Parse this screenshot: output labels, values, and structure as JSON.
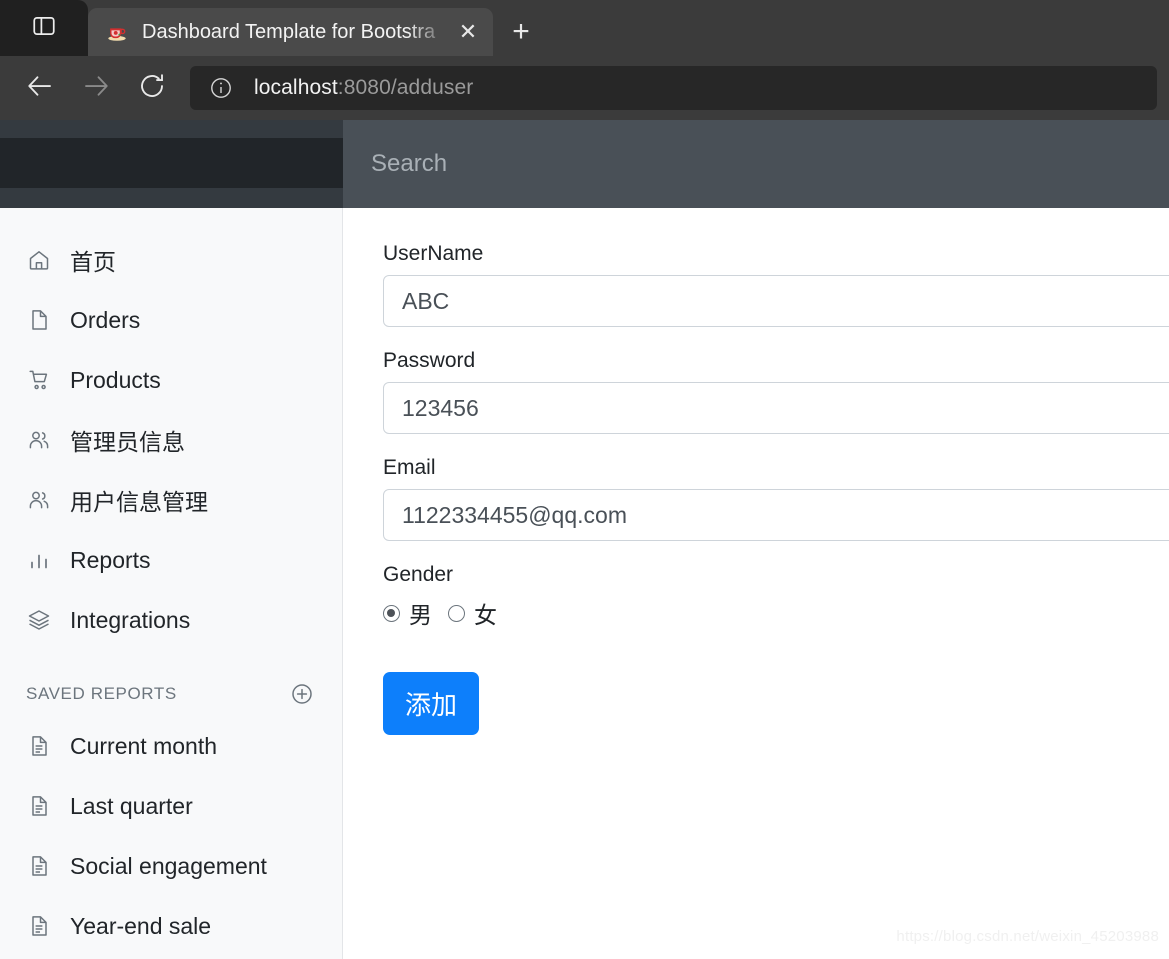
{
  "browser": {
    "window_button_icon": "split-pane-icon",
    "tab": {
      "favicon": "java-coffee-cup-icon",
      "title": "Dashboard Template for Bootstra",
      "close_label": "✕"
    },
    "new_tab_label": "+",
    "nav": {
      "back_icon": "arrow-left-icon",
      "forward_icon": "arrow-right-icon",
      "reload_icon": "reload-icon",
      "info_icon": "info-circle-icon"
    },
    "url": {
      "host": "localhost",
      "rest": ":8080/adduser",
      "full": "localhost:8080/adduser"
    }
  },
  "app": {
    "search_placeholder": "Search",
    "sidebar": {
      "items": [
        {
          "label": "首页",
          "icon": "home-icon"
        },
        {
          "label": "Orders",
          "icon": "file-icon"
        },
        {
          "label": "Products",
          "icon": "cart-icon"
        },
        {
          "label": "管理员信息",
          "icon": "users-icon"
        },
        {
          "label": "用户信息管理",
          "icon": "users-icon"
        },
        {
          "label": "Reports",
          "icon": "bar-chart-icon"
        },
        {
          "label": "Integrations",
          "icon": "layers-icon"
        }
      ],
      "saved_reports_heading": "SAVED REPORTS",
      "add_report_icon": "plus-circle-icon",
      "saved_reports": [
        {
          "label": "Current month",
          "icon": "document-icon"
        },
        {
          "label": "Last quarter",
          "icon": "document-icon"
        },
        {
          "label": "Social engagement",
          "icon": "document-icon"
        },
        {
          "label": "Year-end sale",
          "icon": "document-icon"
        }
      ]
    },
    "form": {
      "username": {
        "label": "UserName",
        "value": "ABC",
        "placeholder": ""
      },
      "password": {
        "label": "Password",
        "value": "123456",
        "placeholder": ""
      },
      "email": {
        "label": "Email",
        "value": "1122334455@qq.com",
        "placeholder": ""
      },
      "gender": {
        "label": "Gender",
        "options": [
          {
            "label": "男",
            "checked": true
          },
          {
            "label": "女",
            "checked": false
          }
        ]
      },
      "submit_label": "添加"
    },
    "watermark": "https://blog.csdn.net/weixin_45203988",
    "colors": {
      "navbar": "#343a40",
      "brand": "#212529",
      "search": "#495057",
      "sidebar": "#f8f9fa",
      "submit": "#0d7ffb"
    }
  }
}
